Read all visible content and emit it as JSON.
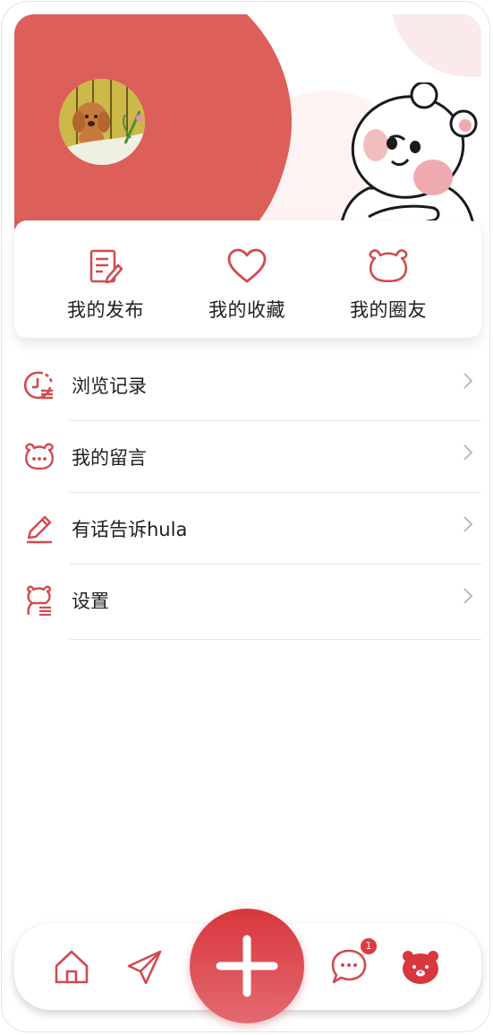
{
  "colors": {
    "accent": "#d8373d",
    "header_red": "#dc5f59",
    "pink": "#f9e1e1",
    "divider": "#e6e6e6"
  },
  "profile": {
    "avatar_icon": "poodle-avatar"
  },
  "quick_actions": [
    {
      "label": "我的发布",
      "icon": "edit-document-icon"
    },
    {
      "label": "我的收藏",
      "icon": "heart-icon"
    },
    {
      "label": "我的圈友",
      "icon": "bear-face-icon"
    }
  ],
  "menu": [
    {
      "label": "浏览记录",
      "icon": "history-clock-icon"
    },
    {
      "label": "我的留言",
      "icon": "bear-chat-icon"
    },
    {
      "label": "有话告诉hula",
      "icon": "pencil-icon"
    },
    {
      "label": "设置",
      "icon": "settings-bear-icon"
    }
  ],
  "tabbar": {
    "items": [
      "home-icon",
      "send-icon",
      "plus-icon",
      "message-icon",
      "profile-bear-icon"
    ],
    "message_badge": "1"
  }
}
